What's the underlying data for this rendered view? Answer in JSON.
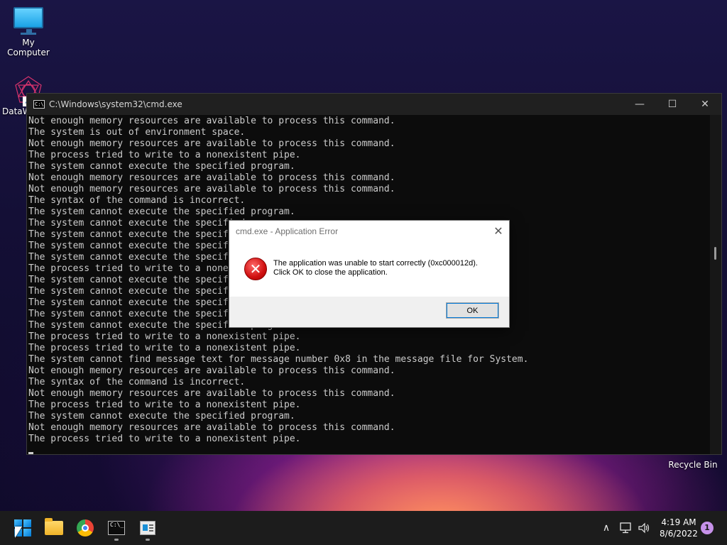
{
  "desktop": {
    "icons": [
      {
        "label": "My Computer",
        "icon": "monitor-icon"
      },
      {
        "label": "DataW",
        "icon": "dataw-app-icon"
      },
      {
        "label": "Recycle Bin",
        "icon": "recycle-bin-icon"
      }
    ]
  },
  "console": {
    "title": "C:\\Windows\\system32\\cmd.exe",
    "controls": {
      "minimize": "—",
      "maximize": "☐",
      "close": "✕"
    },
    "lines": [
      "Not enough memory resources are available to process this command.",
      "The system is out of environment space.",
      "Not enough memory resources are available to process this command.",
      "The process tried to write to a nonexistent pipe.",
      "The system cannot execute the specified program.",
      "Not enough memory resources are available to process this command.",
      "Not enough memory resources are available to process this command.",
      "The syntax of the command is incorrect.",
      "The system cannot execute the specified program.",
      "The system cannot execute the specified program.",
      "The system cannot execute the specified program.",
      "The system cannot execute the specified program.",
      "The system cannot execute the specified program.",
      "The process tried to write to a nonexistent pipe.",
      "The system cannot execute the specified program.",
      "The system cannot execute the specified program.",
      "The system cannot execute the specified program.",
      "The system cannot execute the specified program.",
      "The system cannot execute the specified program.",
      "The process tried to write to a nonexistent pipe.",
      "The process tried to write to a nonexistent pipe.",
      "The system cannot find message text for message number 0x8 in the message file for System.",
      "Not enough memory resources are available to process this command.",
      "The syntax of the command is incorrect.",
      "Not enough memory resources are available to process this command.",
      "The process tried to write to a nonexistent pipe.",
      "The system cannot execute the specified program.",
      "Not enough memory resources are available to process this command.",
      "The process tried to write to a nonexistent pipe."
    ]
  },
  "dialog": {
    "title": "cmd.exe - Application Error",
    "close": "✕",
    "icon": "error-icon",
    "message_line1": "The application was unable to start correctly (0xc000012d).",
    "message_line2": "Click OK to close the application.",
    "ok_label": "OK"
  },
  "taskbar": {
    "apps": [
      "start-icon",
      "file-explorer-icon",
      "chrome-icon",
      "cmd-icon",
      "app-window-icon"
    ],
    "tray": {
      "chevron": "∧",
      "time": "4:19 AM",
      "date": "8/6/2022",
      "notification_count": "1"
    }
  },
  "colors": {
    "console_bg": "#0c0c0c",
    "console_text": "#cccccc",
    "taskbar": "#1c1c1c",
    "accent": "#0078d7"
  }
}
